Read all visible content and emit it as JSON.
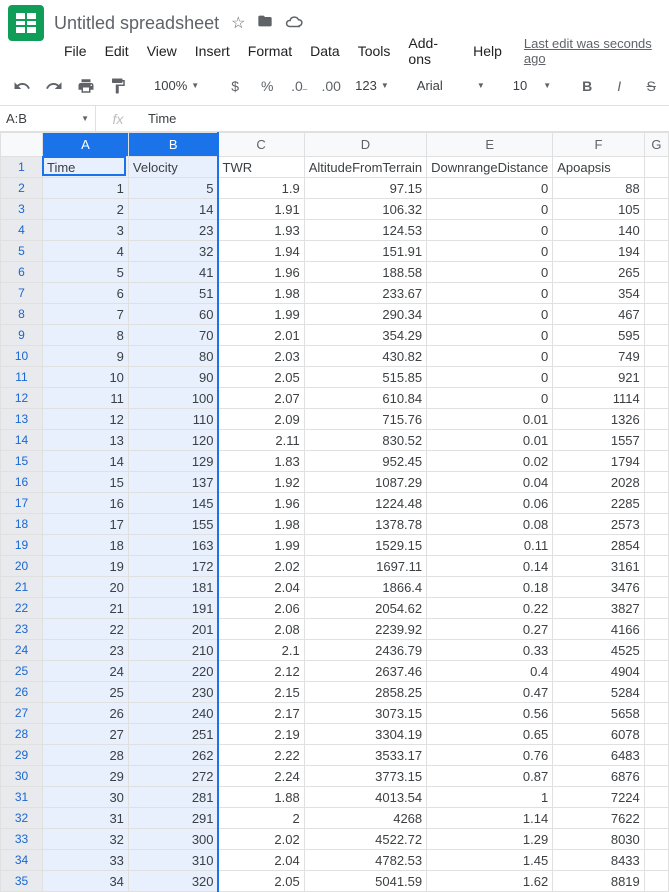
{
  "header": {
    "doc_title": "Untitled spreadsheet",
    "last_edit": "Last edit was seconds ago"
  },
  "menu": {
    "file": "File",
    "edit": "Edit",
    "view": "View",
    "insert": "Insert",
    "format": "Format",
    "data": "Data",
    "tools": "Tools",
    "addons": "Add-ons",
    "help": "Help"
  },
  "toolbar": {
    "zoom": "100%",
    "font": "Arial",
    "font_size": "10",
    "more_formats": "123"
  },
  "name_box": "A:B",
  "formula_value": "Time",
  "columns": [
    "A",
    "B",
    "C",
    "D",
    "E",
    "F",
    "G"
  ],
  "selected_cols": [
    "A",
    "B"
  ],
  "col_headers": {
    "A": "Time",
    "B": "Velocity",
    "C": "TWR",
    "D": "AltitudeFromTerrain",
    "E": "DownrangeDistance",
    "F": "Apoapsis"
  },
  "rows": [
    {
      "A": "1",
      "B": "5",
      "C": "1.9",
      "D": "97.15",
      "E": "0",
      "F": "88"
    },
    {
      "A": "2",
      "B": "14",
      "C": "1.91",
      "D": "106.32",
      "E": "0",
      "F": "105"
    },
    {
      "A": "3",
      "B": "23",
      "C": "1.93",
      "D": "124.53",
      "E": "0",
      "F": "140"
    },
    {
      "A": "4",
      "B": "32",
      "C": "1.94",
      "D": "151.91",
      "E": "0",
      "F": "194"
    },
    {
      "A": "5",
      "B": "41",
      "C": "1.96",
      "D": "188.58",
      "E": "0",
      "F": "265"
    },
    {
      "A": "6",
      "B": "51",
      "C": "1.98",
      "D": "233.67",
      "E": "0",
      "F": "354"
    },
    {
      "A": "7",
      "B": "60",
      "C": "1.99",
      "D": "290.34",
      "E": "0",
      "F": "467"
    },
    {
      "A": "8",
      "B": "70",
      "C": "2.01",
      "D": "354.29",
      "E": "0",
      "F": "595"
    },
    {
      "A": "9",
      "B": "80",
      "C": "2.03",
      "D": "430.82",
      "E": "0",
      "F": "749"
    },
    {
      "A": "10",
      "B": "90",
      "C": "2.05",
      "D": "515.85",
      "E": "0",
      "F": "921"
    },
    {
      "A": "11",
      "B": "100",
      "C": "2.07",
      "D": "610.84",
      "E": "0",
      "F": "1114"
    },
    {
      "A": "12",
      "B": "110",
      "C": "2.09",
      "D": "715.76",
      "E": "0.01",
      "F": "1326"
    },
    {
      "A": "13",
      "B": "120",
      "C": "2.11",
      "D": "830.52",
      "E": "0.01",
      "F": "1557"
    },
    {
      "A": "14",
      "B": "129",
      "C": "1.83",
      "D": "952.45",
      "E": "0.02",
      "F": "1794"
    },
    {
      "A": "15",
      "B": "137",
      "C": "1.92",
      "D": "1087.29",
      "E": "0.04",
      "F": "2028"
    },
    {
      "A": "16",
      "B": "145",
      "C": "1.96",
      "D": "1224.48",
      "E": "0.06",
      "F": "2285"
    },
    {
      "A": "17",
      "B": "155",
      "C": "1.98",
      "D": "1378.78",
      "E": "0.08",
      "F": "2573"
    },
    {
      "A": "18",
      "B": "163",
      "C": "1.99",
      "D": "1529.15",
      "E": "0.11",
      "F": "2854"
    },
    {
      "A": "19",
      "B": "172",
      "C": "2.02",
      "D": "1697.11",
      "E": "0.14",
      "F": "3161"
    },
    {
      "A": "20",
      "B": "181",
      "C": "2.04",
      "D": "1866.4",
      "E": "0.18",
      "F": "3476"
    },
    {
      "A": "21",
      "B": "191",
      "C": "2.06",
      "D": "2054.62",
      "E": "0.22",
      "F": "3827"
    },
    {
      "A": "22",
      "B": "201",
      "C": "2.08",
      "D": "2239.92",
      "E": "0.27",
      "F": "4166"
    },
    {
      "A": "23",
      "B": "210",
      "C": "2.1",
      "D": "2436.79",
      "E": "0.33",
      "F": "4525"
    },
    {
      "A": "24",
      "B": "220",
      "C": "2.12",
      "D": "2637.46",
      "E": "0.4",
      "F": "4904"
    },
    {
      "A": "25",
      "B": "230",
      "C": "2.15",
      "D": "2858.25",
      "E": "0.47",
      "F": "5284"
    },
    {
      "A": "26",
      "B": "240",
      "C": "2.17",
      "D": "3073.15",
      "E": "0.56",
      "F": "5658"
    },
    {
      "A": "27",
      "B": "251",
      "C": "2.19",
      "D": "3304.19",
      "E": "0.65",
      "F": "6078"
    },
    {
      "A": "28",
      "B": "262",
      "C": "2.22",
      "D": "3533.17",
      "E": "0.76",
      "F": "6483"
    },
    {
      "A": "29",
      "B": "272",
      "C": "2.24",
      "D": "3773.15",
      "E": "0.87",
      "F": "6876"
    },
    {
      "A": "30",
      "B": "281",
      "C": "1.88",
      "D": "4013.54",
      "E": "1",
      "F": "7224"
    },
    {
      "A": "31",
      "B": "291",
      "C": "2",
      "D": "4268",
      "E": "1.14",
      "F": "7622"
    },
    {
      "A": "32",
      "B": "300",
      "C": "2.02",
      "D": "4522.72",
      "E": "1.29",
      "F": "8030"
    },
    {
      "A": "33",
      "B": "310",
      "C": "2.04",
      "D": "4782.53",
      "E": "1.45",
      "F": "8433"
    },
    {
      "A": "34",
      "B": "320",
      "C": "2.05",
      "D": "5041.59",
      "E": "1.62",
      "F": "8819"
    }
  ]
}
